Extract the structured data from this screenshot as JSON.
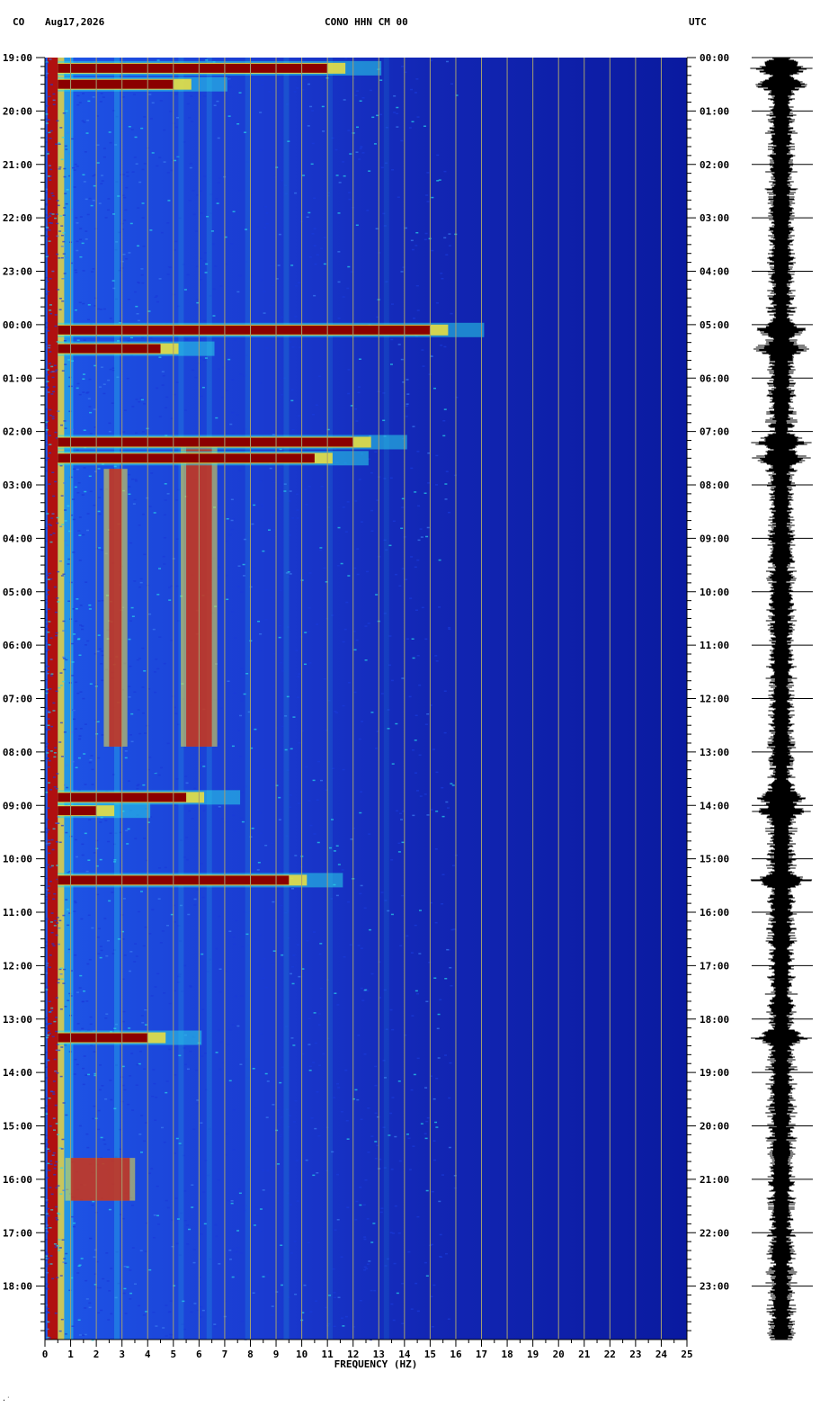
{
  "header": {
    "network": "CO",
    "date": "Aug17,2026",
    "station": "CONO HHN CM 00",
    "timezone": "UTC"
  },
  "corner_mark": "·˙",
  "colors": {
    "background_blue": "#0a1aa0",
    "noise_blue": "#1a3ad8",
    "cyan": "#29d6e8",
    "yellow": "#f2e23a",
    "red": "#8b0000",
    "grid": "#a5a070",
    "trace": "#000000"
  },
  "chart_data": {
    "type": "heatmap",
    "title": "CONO HHN CM 00",
    "xlabel": "FREQUENCY (HZ)",
    "xlim": [
      0,
      25
    ],
    "x_ticks": [
      "0",
      "1",
      "2",
      "3",
      "4",
      "5",
      "6",
      "7",
      "8",
      "9",
      "10",
      "11",
      "12",
      "13",
      "14",
      "15",
      "16",
      "17",
      "18",
      "19",
      "20",
      "21",
      "22",
      "23",
      "24",
      "25"
    ],
    "ylim_hours": [
      0,
      24
    ],
    "y_left_ticks": [
      "19:00",
      "20:00",
      "21:00",
      "22:00",
      "23:00",
      "00:00",
      "01:00",
      "02:00",
      "03:00",
      "04:00",
      "05:00",
      "06:00",
      "07:00",
      "08:00",
      "09:00",
      "10:00",
      "11:00",
      "12:00",
      "13:00",
      "14:00",
      "15:00",
      "16:00",
      "17:00",
      "18:00"
    ],
    "y_right_ticks": [
      "00:00",
      "01:00",
      "02:00",
      "03:00",
      "04:00",
      "05:00",
      "06:00",
      "07:00",
      "08:00",
      "09:00",
      "10:00",
      "11:00",
      "12:00",
      "13:00",
      "14:00",
      "15:00",
      "16:00",
      "17:00",
      "18:00",
      "19:00",
      "20:00",
      "21:00",
      "22:00",
      "23:00"
    ],
    "grid": true,
    "high_energy_bands": [
      {
        "hour": 0.2,
        "fmax": 11.0
      },
      {
        "hour": 0.5,
        "fmax": 5.0
      },
      {
        "hour": 5.1,
        "fmax": 15.0
      },
      {
        "hour": 5.45,
        "fmax": 4.5
      },
      {
        "hour": 7.2,
        "fmax": 12.0
      },
      {
        "hour": 7.5,
        "fmax": 10.5
      },
      {
        "hour": 13.85,
        "fmax": 5.5
      },
      {
        "hour": 14.1,
        "fmax": 2.0
      },
      {
        "hour": 15.4,
        "fmax": 9.5
      },
      {
        "hour": 18.35,
        "fmax": 4.0
      }
    ],
    "persistent_features": [
      {
        "fmin": 2.5,
        "fmax": 3.0,
        "hour_start": 7.7,
        "hour_end": 12.9
      },
      {
        "fmin": 5.5,
        "fmax": 6.5,
        "hour_start": 7.3,
        "hour_end": 12.9
      },
      {
        "fmin": 1.0,
        "fmax": 3.3,
        "hour_start": 20.6,
        "hour_end": 21.4
      }
    ]
  }
}
